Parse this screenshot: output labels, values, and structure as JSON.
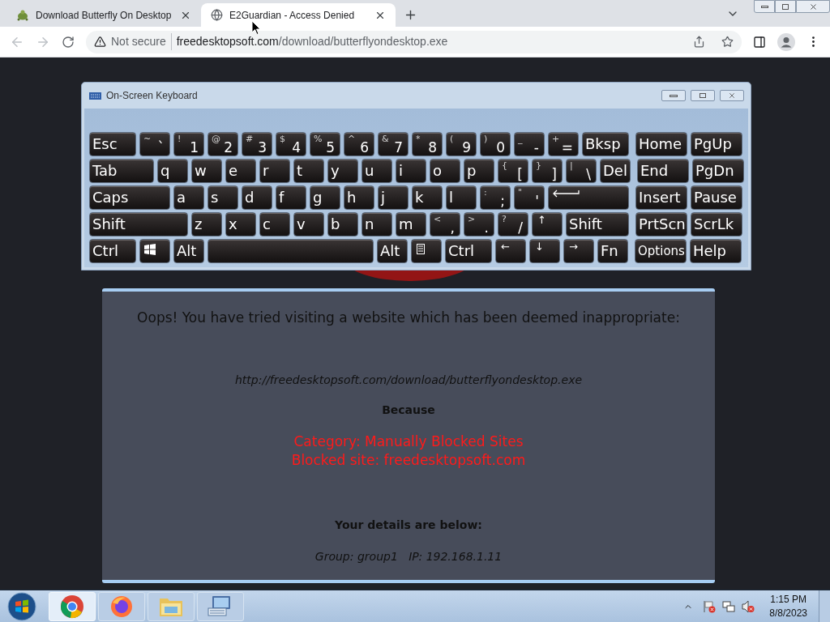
{
  "browser": {
    "tabs": [
      {
        "title": "Download Butterfly On Desktop",
        "selected": false
      },
      {
        "title": "E2Guardian - Access Denied",
        "selected": true
      }
    ],
    "address": {
      "security": "Not secure",
      "host": "freedesktopsoft.com",
      "path": "/download/butterflyondesktop.exe"
    }
  },
  "keyboard": {
    "title": "On-Screen Keyboard",
    "rows": [
      {
        "keys": [
          {
            "kind": "text",
            "label": "Esc"
          },
          {
            "kind": "dual",
            "shift": "~",
            "label": "`"
          },
          {
            "kind": "dual",
            "shift": "!",
            "label": "1"
          },
          {
            "kind": "dual",
            "shift": "@",
            "label": "2"
          },
          {
            "kind": "dual",
            "shift": "#",
            "label": "3"
          },
          {
            "kind": "dual",
            "shift": "$",
            "label": "4"
          },
          {
            "kind": "dual",
            "shift": "%",
            "label": "5"
          },
          {
            "kind": "dual",
            "shift": "^",
            "label": "6"
          },
          {
            "kind": "dual",
            "shift": "&",
            "label": "7"
          },
          {
            "kind": "dual",
            "shift": "*",
            "label": "8"
          },
          {
            "kind": "dual",
            "shift": "(",
            "label": "9"
          },
          {
            "kind": "dual",
            "shift": ")",
            "label": "0"
          },
          {
            "kind": "dual",
            "shift": "_",
            "label": "-"
          },
          {
            "kind": "dual",
            "shift": "+",
            "label": "="
          },
          {
            "kind": "text",
            "label": "Bksp"
          }
        ],
        "nav_keys": [
          {
            "kind": "text",
            "label": "Home"
          },
          {
            "kind": "text",
            "label": "PgUp"
          }
        ]
      },
      {
        "keys": [
          {
            "kind": "text",
            "label": "Tab"
          },
          {
            "kind": "text",
            "label": "q"
          },
          {
            "kind": "text",
            "label": "w"
          },
          {
            "kind": "text",
            "label": "e"
          },
          {
            "kind": "text",
            "label": "r"
          },
          {
            "kind": "text",
            "label": "t"
          },
          {
            "kind": "text",
            "label": "y"
          },
          {
            "kind": "text",
            "label": "u"
          },
          {
            "kind": "text",
            "label": "i"
          },
          {
            "kind": "text",
            "label": "o"
          },
          {
            "kind": "text",
            "label": "p"
          },
          {
            "kind": "dual",
            "shift": "{",
            "label": "["
          },
          {
            "kind": "dual",
            "shift": "}",
            "label": "]"
          },
          {
            "kind": "dual",
            "shift": "|",
            "label": "\\"
          },
          {
            "kind": "text",
            "label": "Del"
          }
        ],
        "nav_keys": [
          {
            "kind": "text",
            "label": "End"
          },
          {
            "kind": "text",
            "label": "PgDn"
          }
        ]
      },
      {
        "keys": [
          {
            "kind": "text",
            "label": "Caps"
          },
          {
            "kind": "text",
            "label": "a"
          },
          {
            "kind": "text",
            "label": "s"
          },
          {
            "kind": "text",
            "label": "d"
          },
          {
            "kind": "text",
            "label": "f"
          },
          {
            "kind": "text",
            "label": "g"
          },
          {
            "kind": "text",
            "label": "h"
          },
          {
            "kind": "text",
            "label": "j"
          },
          {
            "kind": "text",
            "label": "k"
          },
          {
            "kind": "text",
            "label": "l"
          },
          {
            "kind": "dual",
            "shift": ":",
            "label": ";"
          },
          {
            "kind": "dual",
            "shift": "\"",
            "label": "'"
          },
          {
            "kind": "enter"
          }
        ],
        "nav_keys": [
          {
            "kind": "text",
            "label": "Insert"
          },
          {
            "kind": "text",
            "label": "Pause"
          }
        ]
      },
      {
        "keys": [
          {
            "kind": "text",
            "label": "Shift"
          },
          {
            "kind": "text",
            "label": "z"
          },
          {
            "kind": "text",
            "label": "x"
          },
          {
            "kind": "text",
            "label": "c"
          },
          {
            "kind": "text",
            "label": "v"
          },
          {
            "kind": "text",
            "label": "b"
          },
          {
            "kind": "text",
            "label": "n"
          },
          {
            "kind": "text",
            "label": "m"
          },
          {
            "kind": "dual",
            "shift": "<",
            "label": ","
          },
          {
            "kind": "dual",
            "shift": ">",
            "label": "."
          },
          {
            "kind": "dual",
            "shift": "?",
            "label": "/"
          },
          {
            "kind": "arrow",
            "label": "↑"
          },
          {
            "kind": "text",
            "label": "Shift"
          }
        ],
        "nav_keys": [
          {
            "kind": "text",
            "label": "PrtScn"
          },
          {
            "kind": "text",
            "label": "ScrLk"
          }
        ]
      },
      {
        "keys": [
          {
            "kind": "text",
            "label": "Ctrl"
          },
          {
            "kind": "windows"
          },
          {
            "kind": "text",
            "label": "Alt"
          },
          {
            "kind": "space"
          },
          {
            "kind": "text",
            "label": "Alt"
          },
          {
            "kind": "menu"
          },
          {
            "kind": "text",
            "label": "Ctrl"
          },
          {
            "kind": "arrow",
            "label": "←"
          },
          {
            "kind": "arrow",
            "label": "↓"
          },
          {
            "kind": "arrow",
            "label": "→"
          },
          {
            "kind": "text",
            "label": "Fn"
          }
        ],
        "nav_keys": [
          {
            "kind": "small",
            "label": "Options"
          },
          {
            "kind": "text",
            "label": "Help"
          }
        ]
      }
    ]
  },
  "block_page": {
    "heading": "Oops! You have tried visiting a website which has been deemed inappropriate:",
    "url": "http://freedesktopsoft.com/download/butterflyondesktop.exe",
    "because": "Because",
    "reasons": [
      "Category: Manually Blocked Sites",
      "Blocked site: freedesktopsoft.com"
    ],
    "details_heading": "Your details are below:",
    "details": "Group: group1   IP: 192.168.1.11"
  },
  "taskbar": {
    "apps": [
      {
        "selected": true
      },
      {
        "selected": false
      },
      {
        "selected": false
      },
      {
        "selected": false
      }
    ],
    "time": "1:15 PM",
    "date": "8/8/2023"
  }
}
